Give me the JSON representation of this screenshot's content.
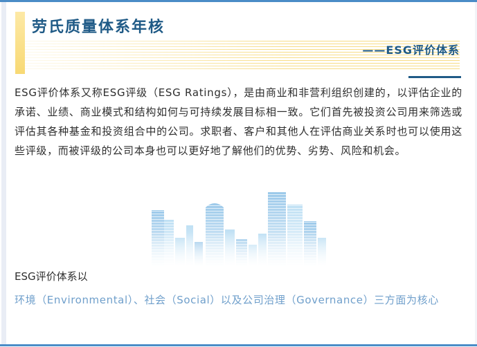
{
  "header": {
    "title": "劳氏质量体系年核",
    "subtitle": "——ESG评价体系"
  },
  "body": {
    "paragraph": "ESG评价体系又称ESG评级（ESG Ratings），是由商业和非营利组织创建的，以评估企业的承诺、业绩、商业模式和结构如何与可持续发展目标相一致。它们首先被投资公司用来筛选或评估其各种基金和投资组合中的公司。求职者、客户和其他人在评估商业关系时也可以使用这些评级，而被评级的公司本身也可以更好地了解他们的优势、劣势、风险和机会。"
  },
  "illustration": {
    "icon": "city-buildings-icon"
  },
  "esg": {
    "lead": "ESG评价体系以",
    "pillars": "环境（Environmental）、社会（Social）以及公司治理（Governance）三方面为核心"
  },
  "colors": {
    "title": "#1f5a86",
    "accent_yellow": "#f8d974",
    "frame_blue": "#4a8cc7",
    "pillars_text": "#6f9fcb",
    "body_text": "#2e2e2e"
  }
}
